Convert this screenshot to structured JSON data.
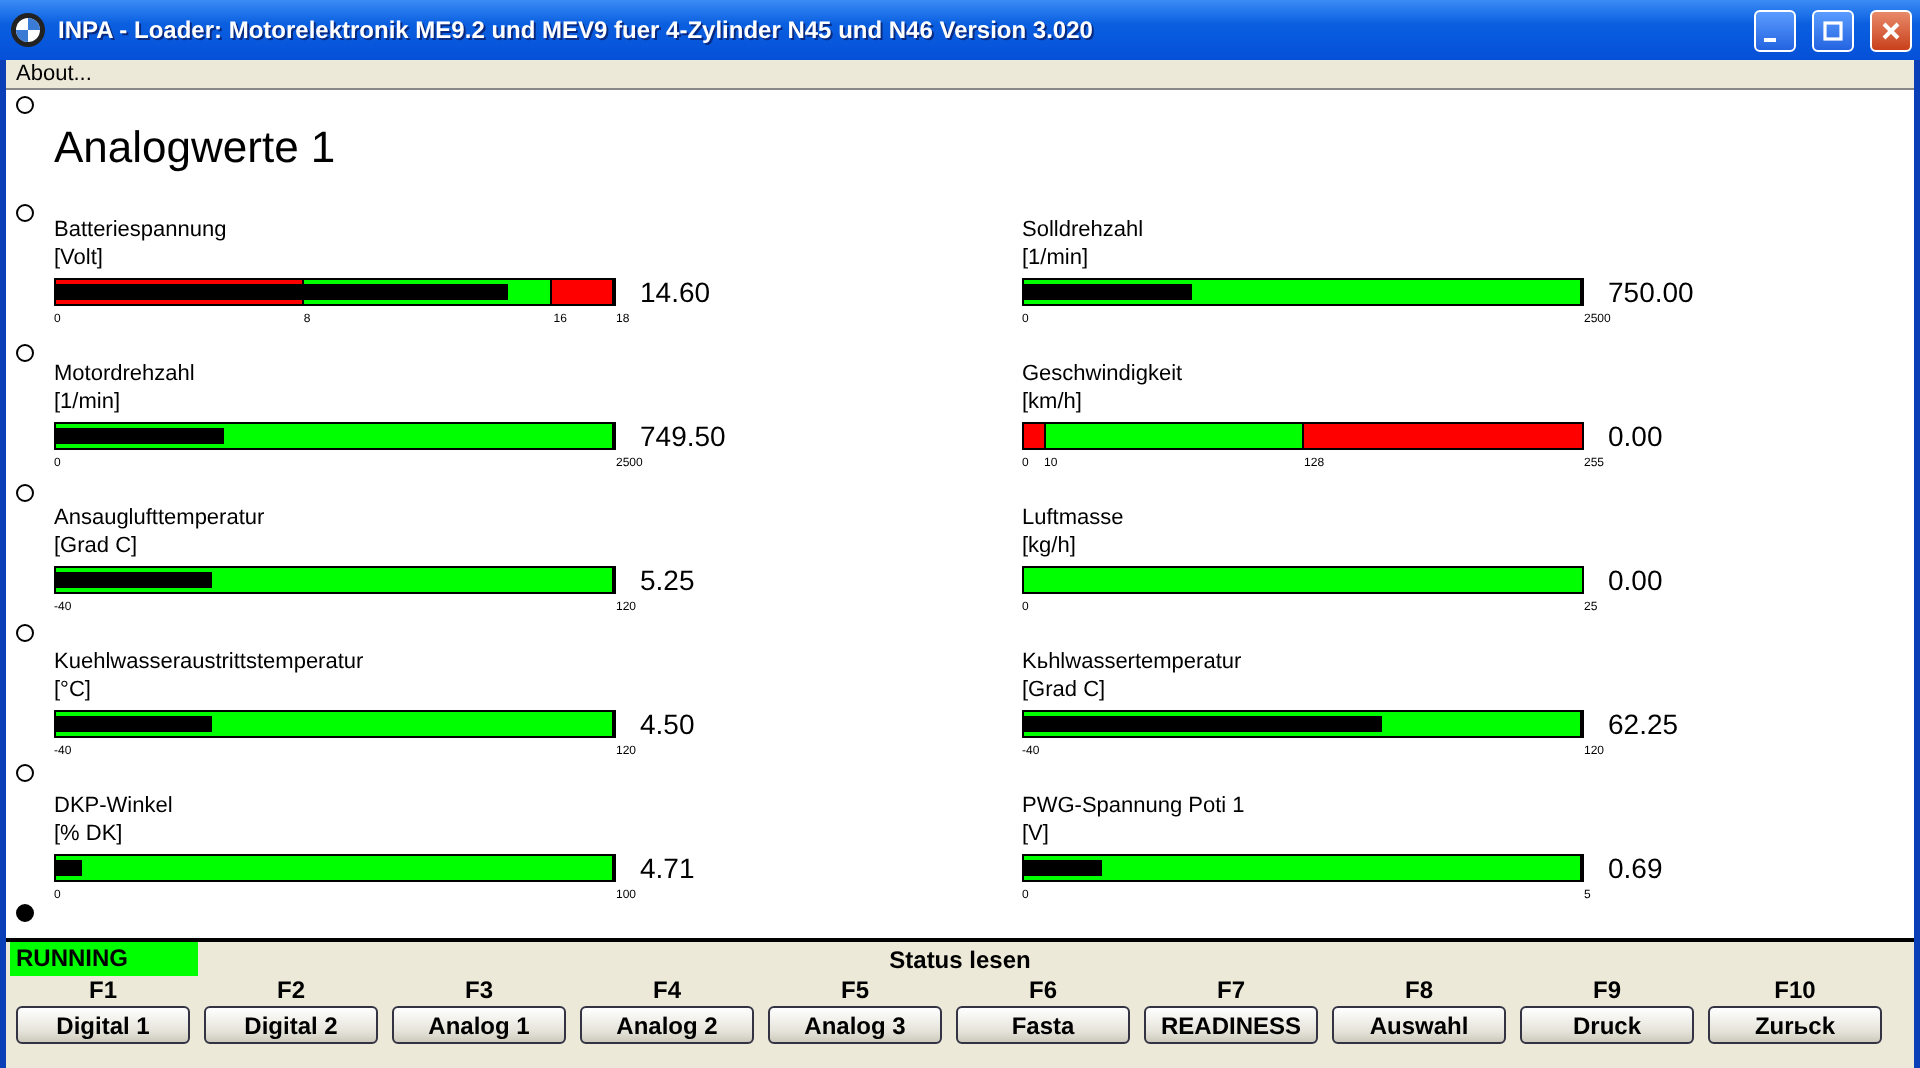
{
  "window": {
    "title": "INPA - Loader:  Motorelektronik ME9.2 und MEV9 fuer 4-Zylinder N45 und N46 Version 3.020"
  },
  "menu": [
    "About..."
  ],
  "markers": [
    {
      "selected": false
    },
    {
      "selected": false
    },
    {
      "selected": false
    },
    {
      "selected": false
    },
    {
      "selected": false
    },
    {
      "selected": false
    },
    {
      "selected": true
    }
  ],
  "page_title": "Analogwerte 1",
  "gauges": [
    {
      "name": "Batteriespannung",
      "unit": "[Volt]",
      "reading": "14.60",
      "level": 0.81,
      "ticks": [
        "0",
        "8",
        "16",
        "18"
      ],
      "zones": [
        {
          "color": "#ff0000"
        },
        {
          "color": "#00ff00"
        },
        {
          "color": "#ff0000"
        }
      ]
    },
    {
      "name": "Solldrehzahl",
      "unit": "[1/min]",
      "reading": "750.00",
      "level": 0.3,
      "ticks": [
        "0",
        "2500"
      ],
      "zones": [
        {
          "color": "#00ff00"
        }
      ]
    },
    {
      "name": "Motordrehzahl",
      "unit": "[1/min]",
      "reading": "749.50",
      "level": 0.3,
      "ticks": [
        "0",
        "2500"
      ],
      "zones": [
        {
          "color": "#00ff00"
        }
      ]
    },
    {
      "name": "Geschwindigkeit",
      "unit": "[km/h]",
      "reading": "0.00",
      "level": 0,
      "ticks": [
        "0",
        "10",
        "128",
        "255"
      ],
      "zones": [
        {
          "color": "#ff0000"
        },
        {
          "color": "#00ff00"
        },
        {
          "color": "#ff0000"
        }
      ]
    },
    {
      "name": "Ansauglufttemperatur",
      "unit": "[Grad C]",
      "reading": "5.25",
      "level": 0.28,
      "ticks": [
        "-40",
        "120"
      ],
      "zones": [
        {
          "color": "#00ff00"
        }
      ]
    },
    {
      "name": "Luftmasse",
      "unit": "[kg/h]",
      "reading": "0.00",
      "ticks": [
        "0",
        "25"
      ],
      "zones": [
        {
          "color": "#00ff00"
        }
      ]
    },
    {
      "name": "Kuehlwasseraustrittstemperatur",
      "unit": "[°C]",
      "reading": "4.50",
      "level": 0.28,
      "ticks": [
        "-40",
        "120"
      ],
      "zones": [
        {
          "color": "#00ff00"
        }
      ]
    },
    {
      "name": "Kьhlwassertemperatur",
      "unit": "[Grad C]",
      "reading": "62.25",
      "level": 0.64,
      "ticks": [
        "-40",
        "120"
      ],
      "zones": [
        {
          "color": "#00ff00"
        }
      ]
    },
    {
      "name": "DKP-Winkel",
      "unit": "[% DK]",
      "reading": "4.71",
      "level": 0.047,
      "ticks": [
        "0",
        "100"
      ],
      "zones": [
        {
          "color": "#00ff00"
        }
      ]
    },
    {
      "name": "PWG-Spannung Poti 1",
      "unit": "[V]",
      "reading": "0.69",
      "level": 0.138,
      "ticks": [
        "0",
        "5"
      ],
      "zones": [
        {
          "color": "#00ff00"
        }
      ]
    }
  ],
  "status": {
    "state": "RUNNING",
    "message": "Status lesen"
  },
  "function_keys": [
    {
      "key": "F1",
      "label": "Digital 1"
    },
    {
      "key": "F2",
      "label": "Digital 2"
    },
    {
      "key": "F3",
      "label": "Analog 1"
    },
    {
      "key": "F4",
      "label": "Analog 2"
    },
    {
      "key": "F5",
      "label": "Analog 3"
    },
    {
      "key": "F6",
      "label": "Fasta"
    },
    {
      "key": "F7",
      "label": "READINESS"
    },
    {
      "key": "F8",
      "label": "Auswahl"
    },
    {
      "key": "F9",
      "label": "Druck"
    },
    {
      "key": "F10",
      "label": "Zurьck"
    }
  ]
}
